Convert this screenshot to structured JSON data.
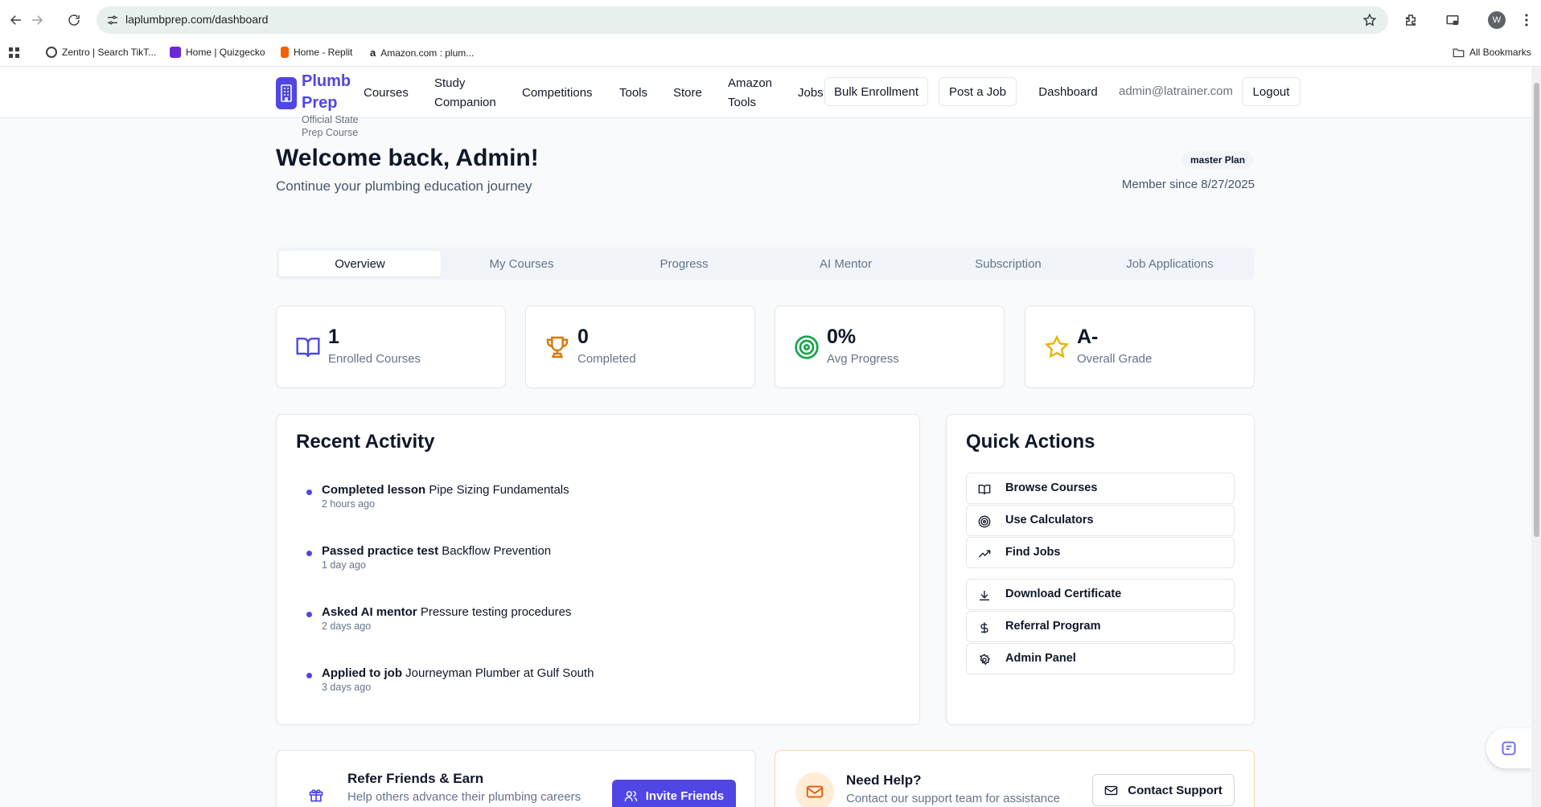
{
  "browser": {
    "url": "laplumbprep.com/dashboard",
    "profile_initial": "W",
    "bookmarks": [
      {
        "label": "Zentro | Search TikT..."
      },
      {
        "label": "Home | Quizgecko"
      },
      {
        "label": "Home - Replit"
      },
      {
        "label": "Amazon.com : plum..."
      }
    ],
    "all_bookmarks": "All Bookmarks"
  },
  "header": {
    "logo_line1": "Plumb",
    "logo_line2": "Prep",
    "logo_sub_line1": "Official State",
    "logo_sub_line2": "Prep Course",
    "nav": {
      "courses": "Courses",
      "study_1": "Study",
      "study_2": "Companion",
      "competitions": "Competitions",
      "tools": "Tools",
      "store": "Store",
      "amazon_1": "Amazon",
      "amazon_2": "Tools",
      "jobs": "Jobs"
    },
    "bulk_enrollment": "Bulk Enrollment",
    "post_job": "Post a Job",
    "dashboard": "Dashboard",
    "email": "admin@latrainer.com",
    "logout": "Logout"
  },
  "welcome": {
    "title": "Welcome back, Admin!",
    "subtitle": "Continue your plumbing education journey",
    "plan": "master Plan",
    "member_since": "Member since 8/27/2025"
  },
  "tabs": [
    "Overview",
    "My Courses",
    "Progress",
    "AI Mentor",
    "Subscription",
    "Job Applications"
  ],
  "stats": [
    {
      "value": "1",
      "label": "Enrolled Courses",
      "icon": "book-open-icon",
      "color": "#4f46e5"
    },
    {
      "value": "0",
      "label": "Completed",
      "icon": "trophy-icon",
      "color": "#d97706"
    },
    {
      "value": "0%",
      "label": "Avg Progress",
      "icon": "target-icon",
      "color": "#16a34a"
    },
    {
      "value": "A-",
      "label": "Overall Grade",
      "icon": "star-icon",
      "color": "#eab308"
    }
  ],
  "recent_activity": {
    "title": "Recent Activity",
    "items": [
      {
        "verb": "Completed lesson",
        "object": "Pipe Sizing Fundamentals",
        "time": "2 hours ago"
      },
      {
        "verb": "Passed practice test",
        "object": "Backflow Prevention",
        "time": "1 day ago"
      },
      {
        "verb": "Asked AI mentor",
        "object": "Pressure testing procedures",
        "time": "2 days ago"
      },
      {
        "verb": "Applied to job",
        "object": "Journeyman Plumber at Gulf South",
        "time": "3 days ago"
      }
    ]
  },
  "quick_actions": {
    "title": "Quick Actions",
    "items": [
      {
        "label": "Browse Courses",
        "icon": "book-open-icon"
      },
      {
        "label": "Use Calculators",
        "icon": "target-icon"
      },
      {
        "label": "Find Jobs",
        "icon": "trending-up-icon"
      },
      {
        "label": "Download Certificate",
        "icon": "download-icon"
      },
      {
        "label": "Referral Program",
        "icon": "dollar-icon"
      },
      {
        "label": "Admin Panel",
        "icon": "settings-icon"
      }
    ]
  },
  "refer": {
    "title": "Refer Friends & Earn",
    "subtitle": "Help others advance their plumbing careers",
    "button": "Invite Friends"
  },
  "help": {
    "title": "Need Help?",
    "subtitle": "Contact our support team for assistance",
    "button": "Contact Support"
  },
  "colors": {
    "brand": "#4f46e5",
    "text": "#0f172a",
    "muted": "#64748b",
    "border": "#e5e7eb"
  }
}
